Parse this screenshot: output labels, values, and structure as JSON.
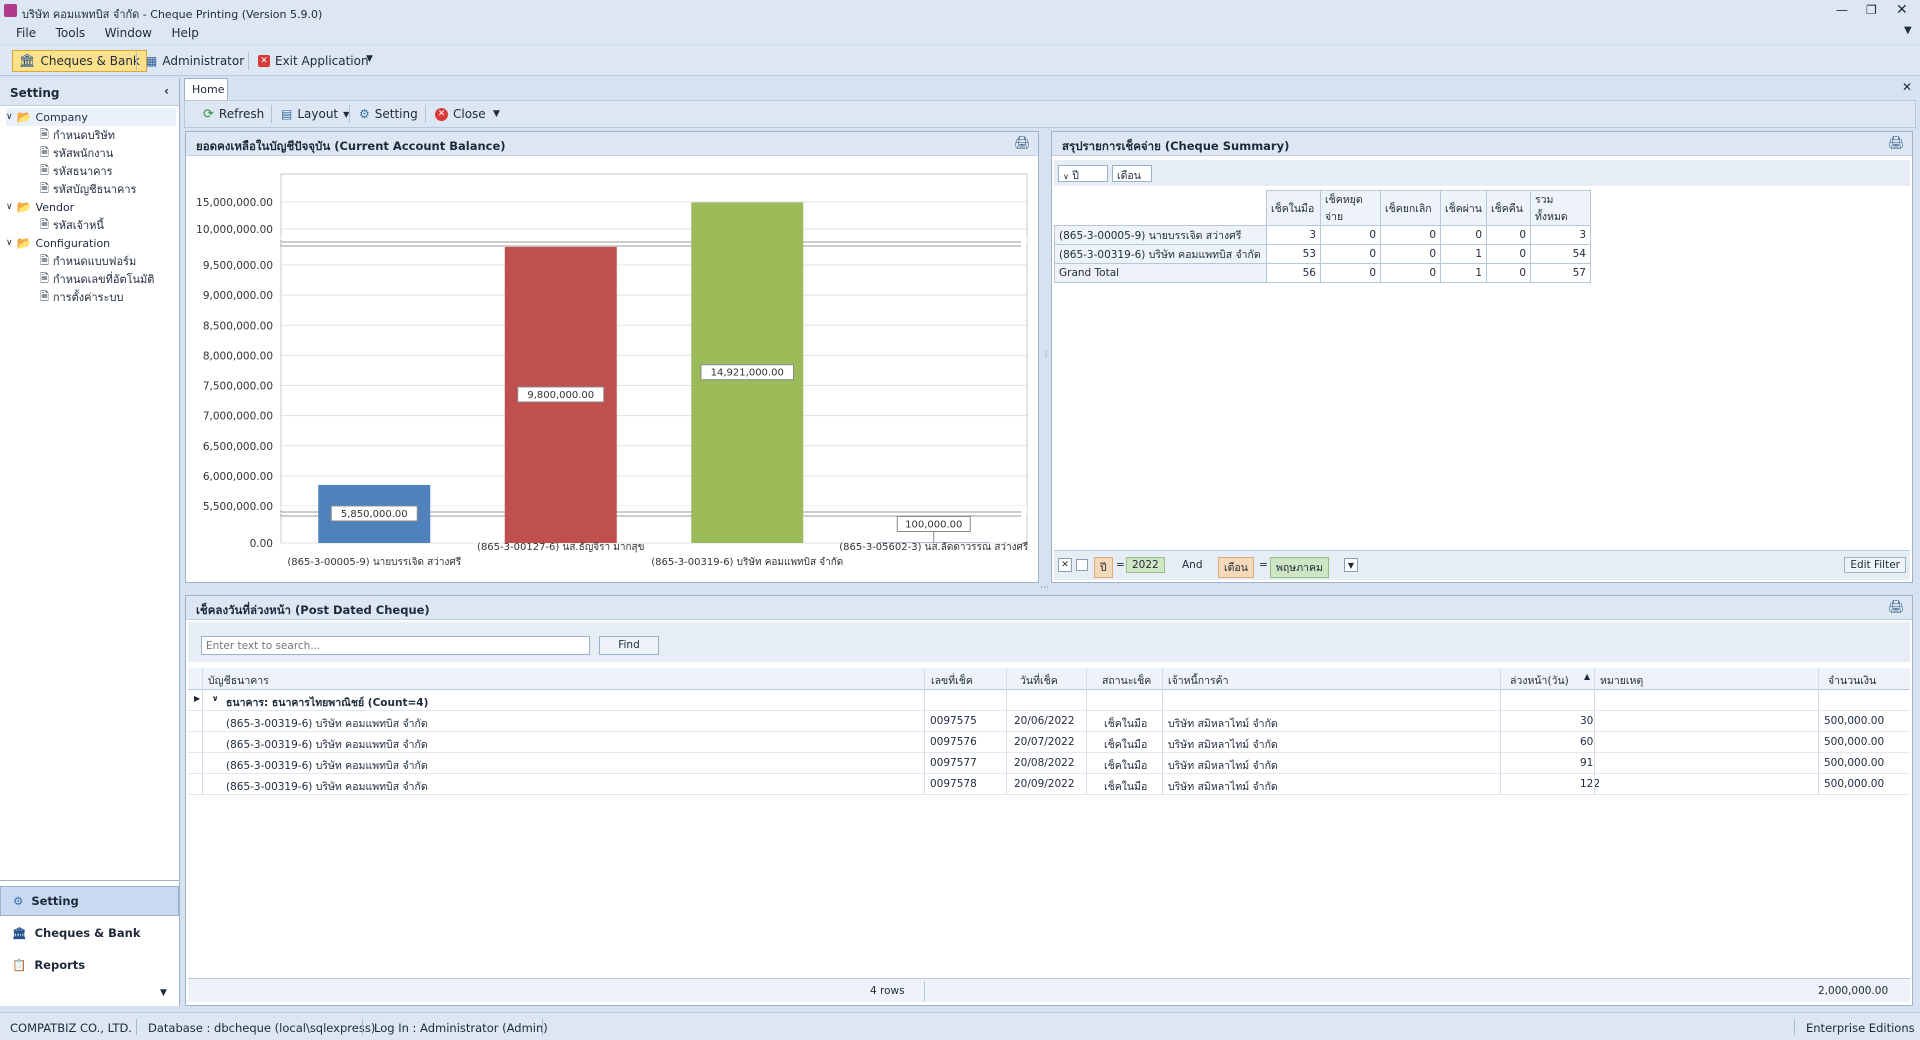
{
  "window": {
    "title": "บริษัท คอมแพทบิส จำกัด - Cheque Printing (Version 5.9.0)"
  },
  "menu": [
    "File",
    "Tools",
    "Window",
    "Help"
  ],
  "toolbar": {
    "cheques_bank": "Cheques & Bank",
    "administrator": "Administrator",
    "exit": "Exit Application"
  },
  "sidebar": {
    "title": "Setting",
    "groups": [
      {
        "label": "Company",
        "items": [
          "กำหนดบริษัท",
          "รหัสพนักงาน",
          "รหัสธนาคาร",
          "รหัสบัญชีธนาคาร"
        ]
      },
      {
        "label": "Vendor",
        "items": [
          "รหัสเจ้าหนี้"
        ]
      },
      {
        "label": "Configuration",
        "items": [
          "กำหนดแบบฟอร์ม",
          "กำหนดเลขที่อัตโนมัติ",
          "การตั้งค่าระบบ"
        ]
      }
    ],
    "nav": [
      "Setting",
      "Cheques & Bank",
      "Reports"
    ]
  },
  "tabs": {
    "home": "Home"
  },
  "home_toolbar": {
    "refresh": "Refresh",
    "layout": "Layout",
    "setting": "Setting",
    "close": "Close"
  },
  "balance_panel": {
    "title": "ยอดคงเหลือในบัญชีปัจจุบัน (Current Account Balance)"
  },
  "chart_data": {
    "type": "bar",
    "title": "",
    "categories": [
      "(865-3-00005-9) นายบรรเจิด สว่างศรี",
      "(865-3-00127-6) นส.ธัญจิรา มากสุข",
      "(865-3-00319-6) บริษัท คอมแพทบิส จำกัด",
      "(865-3-05602-3) นส.ลัดดาวรรณ สว่างศรี"
    ],
    "values": [
      5850000,
      9800000,
      14921000,
      100000
    ],
    "value_labels": [
      "5,850,000.00",
      "9,800,000.00",
      "14,921,000.00",
      "100,000.00"
    ],
    "colors": [
      "#4f81bd",
      "#c0504d",
      "#9bbb59",
      "#8064a2"
    ],
    "y_ticks": [
      "15,000,000.00",
      "10,000,000.00",
      "9,500,000.00",
      "9,000,000.00",
      "8,500,000.00",
      "8,000,000.00",
      "7,500,000.00",
      "7,000,000.00",
      "6,500,000.00",
      "6,000,000.00",
      "5,500,000.00",
      "0.00"
    ],
    "axis_breaks": "two scale breaks between 0.00-5,500,000.00 and 10,000,000.00-15,000,000.00",
    "grid": true,
    "legend": "none"
  },
  "summary_panel": {
    "title": "สรุปรายการเช็คจ่าย (Cheque Summary)",
    "field_year": "ปี",
    "field_month": "เดือน",
    "columns": [
      "เช็คในมือ",
      "เช็คหยุดจ่าย",
      "เช็คยกเลิก",
      "เช็คผ่าน",
      "เช็คคืน",
      "รวมทั้งหมด"
    ],
    "rows": [
      {
        "label": "(865-3-00005-9) นายบรรเจิด สว่างศรี",
        "values": [
          "3",
          "0",
          "0",
          "0",
          "0",
          "3"
        ]
      },
      {
        "label": "(865-3-00319-6) บริษัท คอมแพทบิส จำกัด",
        "values": [
          "53",
          "0",
          "0",
          "1",
          "0",
          "54"
        ]
      },
      {
        "label": "Grand Total",
        "values": [
          "56",
          "0",
          "0",
          "1",
          "0",
          "57"
        ]
      }
    ],
    "filter": {
      "year_label": "ปี",
      "eq": "=",
      "year": "2022",
      "and": "And",
      "month_label": "เดือน",
      "month": "พฤษภาคม",
      "edit_filter": "Edit Filter"
    }
  },
  "pdc_panel": {
    "title": "เช็คลงวันที่ล่วงหน้า (Post Dated Cheque)",
    "search_placeholder": "Enter text to search...",
    "find": "Find",
    "columns": [
      "บัญชีธนาคาร",
      "เลขที่เช็ค",
      "วันที่เช็ค",
      "สถานะเช็ค",
      "เจ้าหนี้การค้า",
      "ล่วงหน้า(วัน)",
      "หมายเหตุ",
      "จำนวนเงิน"
    ],
    "group_label": "ธนาคาร: ธนาคารไทยพาณิชย์ (Count=4)",
    "rows": [
      {
        "account": "(865-3-00319-6) บริษัท คอมแพทบิส จำกัด",
        "no": "0097575",
        "date": "20/06/2022",
        "status": "เช็คในมือ",
        "vendor": "บริษัท สมิหลาไทม์ จำกัด",
        "days": "30",
        "note": "",
        "amount": "500,000.00"
      },
      {
        "account": "(865-3-00319-6) บริษัท คอมแพทบิส จำกัด",
        "no": "0097576",
        "date": "20/07/2022",
        "status": "เช็คในมือ",
        "vendor": "บริษัท สมิหลาไทม์ จำกัด",
        "days": "60",
        "note": "",
        "amount": "500,000.00"
      },
      {
        "account": "(865-3-00319-6) บริษัท คอมแพทบิส จำกัด",
        "no": "0097577",
        "date": "20/08/2022",
        "status": "เช็คในมือ",
        "vendor": "บริษัท สมิหลาไทม์ จำกัด",
        "days": "91",
        "note": "",
        "amount": "500,000.00"
      },
      {
        "account": "(865-3-00319-6) บริษัท คอมแพทบิส จำกัด",
        "no": "0097578",
        "date": "20/09/2022",
        "status": "เช็คในมือ",
        "vendor": "บริษัท สมิหลาไทม์ จำกัด",
        "days": "122",
        "note": "",
        "amount": "500,000.00"
      }
    ],
    "footer_count": "4 rows",
    "footer_total": "2,000,000.00"
  },
  "statusbar": {
    "company": "COMPATBIZ CO., LTD.",
    "database": "Database : dbcheque (local\\sqlexpress)",
    "login": "Log In : Administrator (Admin)",
    "edition": "Enterprise Editions"
  }
}
